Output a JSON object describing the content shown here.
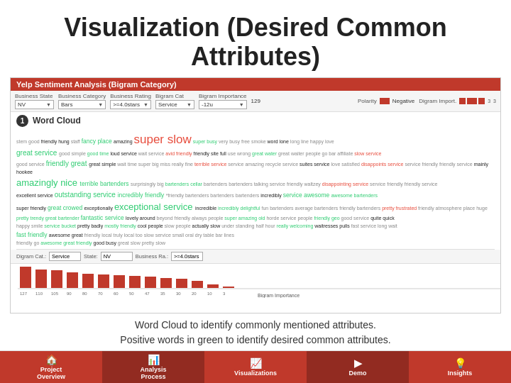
{
  "page": {
    "title_line1": "Visualization (Desired Common",
    "title_line2": "Attributes)"
  },
  "dashboard": {
    "header": "Yelp Sentiment Analysis (Bigram Category)",
    "filters": {
      "state_label": "Business State",
      "state_value": "NV",
      "category_label": "Business Category",
      "category_value": "Bars",
      "rating_label": "Business Rating",
      "rating_value": ">=4.0stars",
      "bigram_cat_label": "Bigram Cat",
      "bigram_cat_value": "Service",
      "importance_label": "Bigram Importance",
      "importance_value": "-12u",
      "count_value": "129",
      "polarity_label": "Polarity",
      "legend_negative": "Negative",
      "range_label": "Digram Import.",
      "range_min": "3",
      "range_max": "3"
    }
  },
  "word_cloud": {
    "section_number": "1",
    "section_title": "Word Cloud"
  },
  "description": {
    "line1": "Word Cloud to identify commonly mentioned attributes.",
    "line2": "Positive words in green to identify desired common",
    "line3": "attributes."
  },
  "bottom_nav": {
    "items": [
      {
        "id": "project-overview",
        "label": "Project\nOverview",
        "icon": "🏠"
      },
      {
        "id": "analysis-process",
        "label": "Analysis\nProcess",
        "icon": "📊"
      },
      {
        "id": "visualizations",
        "label": "Visualizations",
        "icon": "📈"
      },
      {
        "id": "demo",
        "label": "Demo",
        "icon": "▶"
      },
      {
        "id": "insights",
        "label": "Insights",
        "icon": "💡"
      }
    ]
  },
  "bigram_chart": {
    "filter_cat": "Service",
    "filter_state": "NV",
    "filter_business": ">=4.0stars",
    "x_labels": [
      "127",
      "110",
      "105",
      "90",
      "80",
      "70",
      "60",
      "50",
      "47",
      "35",
      "30",
      "20",
      "10",
      "3"
    ],
    "axis_title": "Bigram Importance"
  }
}
